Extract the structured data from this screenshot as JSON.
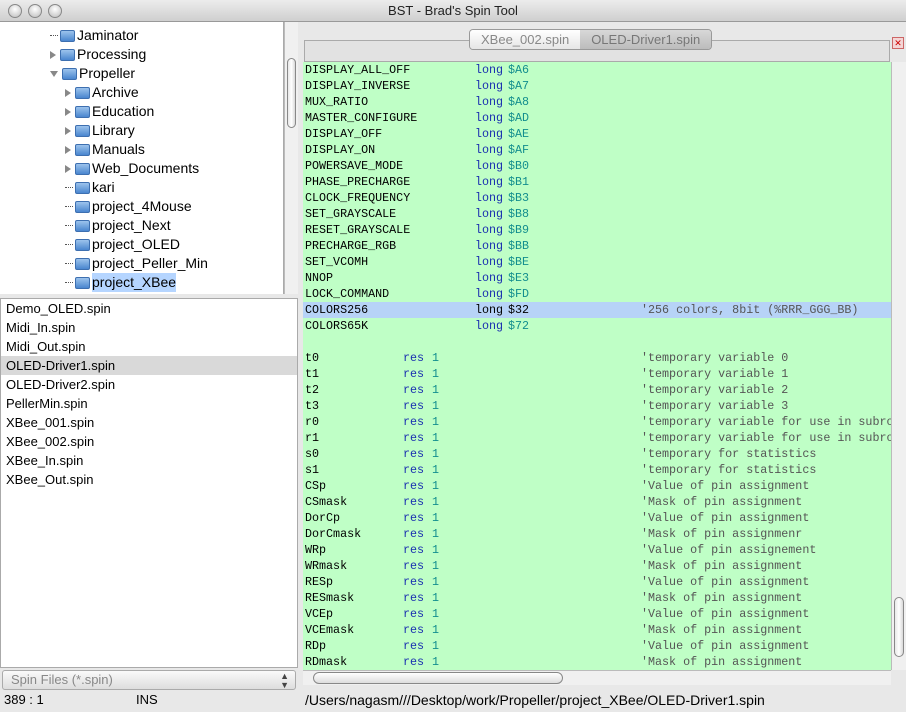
{
  "window": {
    "title": "BST - Brad's Spin Tool"
  },
  "tree": [
    {
      "label": "Jaminator",
      "indent": 1,
      "type": "leaf"
    },
    {
      "label": "Processing",
      "indent": 1,
      "type": "closed"
    },
    {
      "label": "Propeller",
      "indent": 1,
      "type": "open"
    },
    {
      "label": "Archive",
      "indent": 2,
      "type": "closed"
    },
    {
      "label": "Education",
      "indent": 2,
      "type": "closed"
    },
    {
      "label": "Library",
      "indent": 2,
      "type": "closed"
    },
    {
      "label": "Manuals",
      "indent": 2,
      "type": "closed"
    },
    {
      "label": "Web_Documents",
      "indent": 2,
      "type": "closed"
    },
    {
      "label": "kari",
      "indent": 2,
      "type": "leaf"
    },
    {
      "label": "project_4Mouse",
      "indent": 2,
      "type": "leaf"
    },
    {
      "label": "project_Next",
      "indent": 2,
      "type": "leaf"
    },
    {
      "label": "project_OLED",
      "indent": 2,
      "type": "leaf"
    },
    {
      "label": "project_Peller_Min",
      "indent": 2,
      "type": "leaf"
    },
    {
      "label": "project_XBee",
      "indent": 2,
      "type": "leaf",
      "selected": true
    }
  ],
  "files": [
    "Demo_OLED.spin",
    "Midi_In.spin",
    "Midi_Out.spin",
    "OLED-Driver1.spin",
    "OLED-Driver2.spin",
    "PellerMin.spin",
    "XBee_001.spin",
    "XBee_002.spin",
    "XBee_In.spin",
    "XBee_Out.spin"
  ],
  "active_file": "OLED-Driver1.spin",
  "filter": "Spin Files (*.spin)",
  "status": {
    "position": "389 : 1",
    "mode": "INS",
    "path": "/Users/nagasm///Desktop/work/Propeller/project_XBee/OLED-Driver1.spin"
  },
  "tabs": [
    {
      "label": "XBee_002.spin",
      "active": false
    },
    {
      "label": "OLED-Driver1.spin",
      "active": true
    }
  ],
  "colors": {
    "editor_bg": "#bfffc6",
    "highlight": "#b7d3f7",
    "keyword": "#1a2fb0",
    "number": "#138e8e"
  },
  "code": [
    {
      "name": "DISPLAY_ALL_OFF",
      "kw": "long",
      "val": "$A6"
    },
    {
      "name": "DISPLAY_INVERSE",
      "kw": "long",
      "val": "$A7"
    },
    {
      "name": "MUX_RATIO",
      "kw": "long",
      "val": "$A8"
    },
    {
      "name": "MASTER_CONFIGURE",
      "kw": "long",
      "val": "$AD"
    },
    {
      "name": "DISPLAY_OFF",
      "kw": "long",
      "val": "$AE"
    },
    {
      "name": "DISPLAY_ON",
      "kw": "long",
      "val": "$AF"
    },
    {
      "name": "POWERSAVE_MODE",
      "kw": "long",
      "val": "$B0"
    },
    {
      "name": "PHASE_PRECHARGE",
      "kw": "long",
      "val": "$B1"
    },
    {
      "name": "CLOCK_FREQUENCY",
      "kw": "long",
      "val": "$B3"
    },
    {
      "name": "SET_GRAYSCALE",
      "kw": "long",
      "val": "$B8"
    },
    {
      "name": "RESET_GRAYSCALE",
      "kw": "long",
      "val": "$B9"
    },
    {
      "name": "PRECHARGE_RGB",
      "kw": "long",
      "val": "$BB"
    },
    {
      "name": "SET_VCOMH",
      "kw": "long",
      "val": "$BE"
    },
    {
      "name": "NNOP",
      "kw": "long",
      "val": "$E3"
    },
    {
      "name": "LOCK_COMMAND",
      "kw": "long",
      "val": "$FD"
    },
    {
      "name": "COLORS256",
      "kw": "long",
      "val": "$32",
      "comment": "'256 colors, 8bit (%RRR_GGG_BB)",
      "highlight": true
    },
    {
      "name": "COLORS65K",
      "kw": "long",
      "val": "$72"
    },
    {},
    {
      "name": "t0",
      "kw": "res",
      "val": "1",
      "comment": "'temporary variable 0"
    },
    {
      "name": "t1",
      "kw": "res",
      "val": "1",
      "comment": "'temporary variable 1"
    },
    {
      "name": "t2",
      "kw": "res",
      "val": "1",
      "comment": "'temporary variable 2"
    },
    {
      "name": "t3",
      "kw": "res",
      "val": "1",
      "comment": "'temporary variable 3"
    },
    {
      "name": "r0",
      "kw": "res",
      "val": "1",
      "comment": "'temporary variable for use in subroutines"
    },
    {
      "name": "r1",
      "kw": "res",
      "val": "1",
      "comment": "'temporary variable for use in subroutines"
    },
    {
      "name": "s0",
      "kw": "res",
      "val": "1",
      "comment": "'temporary for statistics"
    },
    {
      "name": "s1",
      "kw": "res",
      "val": "1",
      "comment": "'temporary for statistics"
    },
    {
      "name": "CSp",
      "kw": "res",
      "val": "1",
      "comment": "'Value of pin assignment"
    },
    {
      "name": "CSmask",
      "kw": "res",
      "val": "1",
      "comment": "'Mask of pin assignment"
    },
    {
      "name": "DorCp",
      "kw": "res",
      "val": "1",
      "comment": "'Value of pin assignment"
    },
    {
      "name": "DorCmask",
      "kw": "res",
      "val": "1",
      "comment": "'Mask of pin assignmenr"
    },
    {
      "name": "WRp",
      "kw": "res",
      "val": "1",
      "comment": "'Value of pin assignement"
    },
    {
      "name": "WRmask",
      "kw": "res",
      "val": "1",
      "comment": "'Mask of pin assignment"
    },
    {
      "name": "RESp",
      "kw": "res",
      "val": "1",
      "comment": "'Value of pin assignment"
    },
    {
      "name": "RESmask",
      "kw": "res",
      "val": "1",
      "comment": "'Mask of pin assignment"
    },
    {
      "name": "VCEp",
      "kw": "res",
      "val": "1",
      "comment": "'Value of pin assignment"
    },
    {
      "name": "VCEmask",
      "kw": "res",
      "val": "1",
      "comment": "'Mask of pin assignment"
    },
    {
      "name": "RDp",
      "kw": "res",
      "val": "1",
      "comment": "'Value of pin assignment"
    },
    {
      "name": "RDmask",
      "kw": "res",
      "val": "1",
      "comment": "'Mask of pin assignment"
    }
  ]
}
